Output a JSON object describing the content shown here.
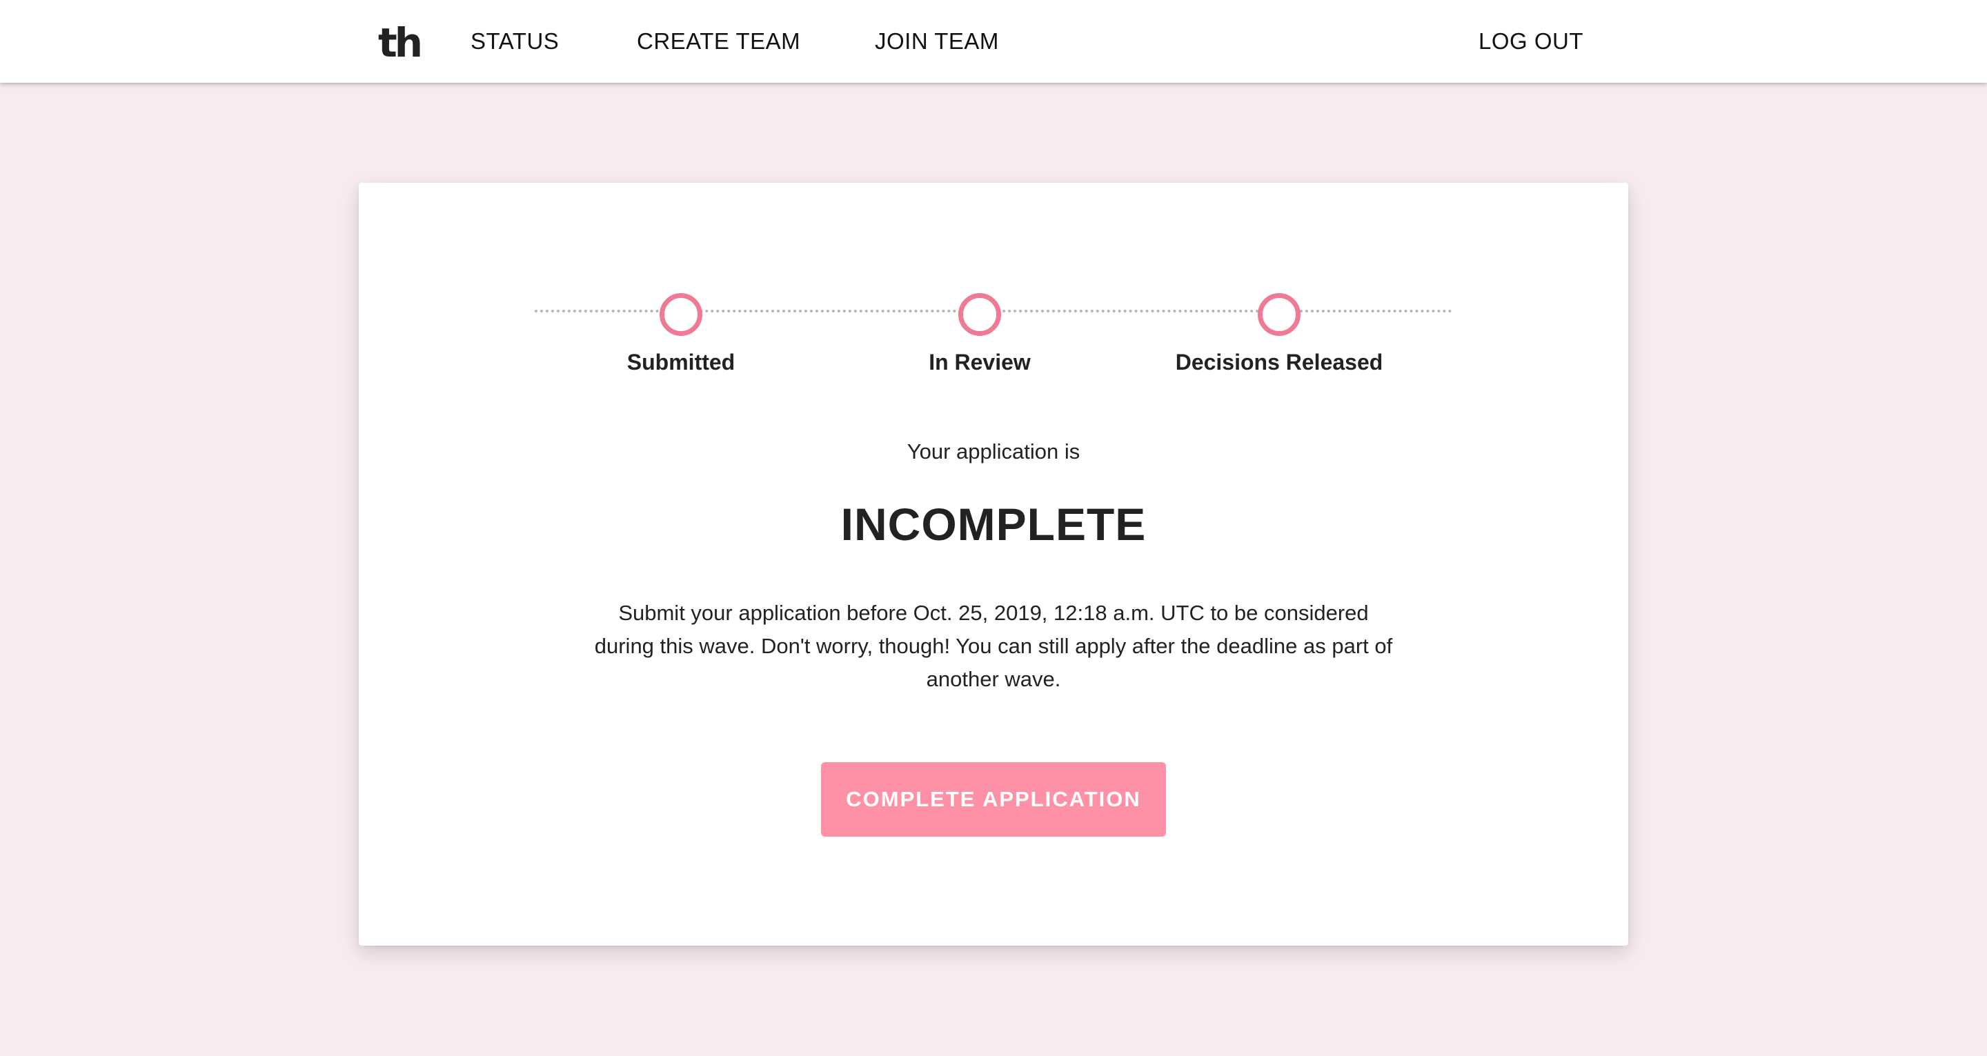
{
  "header": {
    "logo_text": "th",
    "nav": {
      "status": "STATUS",
      "create_team": "CREATE TEAM",
      "join_team": "JOIN TEAM",
      "log_out": "LOG OUT"
    }
  },
  "progress": {
    "steps": [
      {
        "label": "Submitted"
      },
      {
        "label": "In Review"
      },
      {
        "label": "Decisions Released"
      }
    ],
    "accent_color": "#ee7a93"
  },
  "status": {
    "intro": "Your application is",
    "value": "INCOMPLETE",
    "message": "Submit your application before Oct. 25, 2019, 12:18 a.m. UTC to be considered during this wave. Don't worry, though! You can still apply after the deadline as part of another wave.",
    "button_label": "COMPLETE APPLICATION",
    "button_color": "#ff91a6"
  },
  "colors": {
    "background": "#f7ebee",
    "card": "#ffffff",
    "text": "#222222"
  }
}
